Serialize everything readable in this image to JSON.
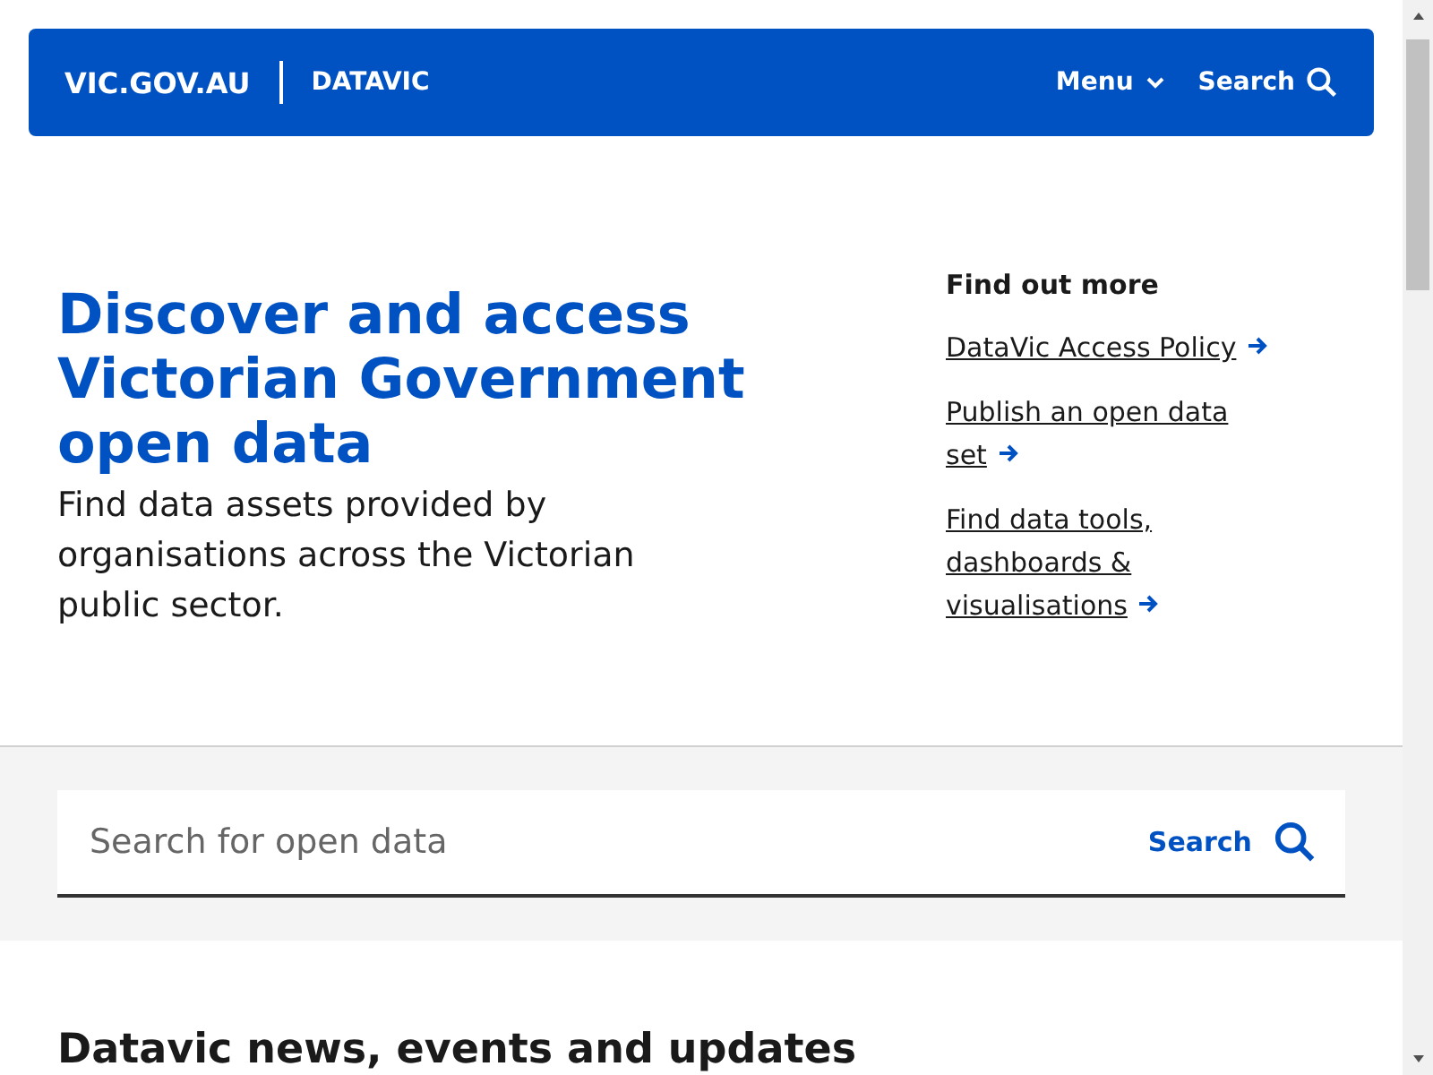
{
  "header": {
    "site": "VIC.GOV.AU",
    "section": "DATAVIC",
    "menu": "Menu",
    "search": "Search"
  },
  "hero": {
    "title": "Discover and access Victorian Government open data",
    "intro": "Find data assets provided by organisations across the Victorian public sector.",
    "aside": {
      "heading": "Find out more",
      "links": [
        "DataVic Access Policy",
        "Publish an open data set",
        "Find data tools, dashboards & visualisations"
      ]
    }
  },
  "search": {
    "placeholder": "Search for open data",
    "button": "Search"
  },
  "news": {
    "heading": "Datavic news, events and updates"
  }
}
